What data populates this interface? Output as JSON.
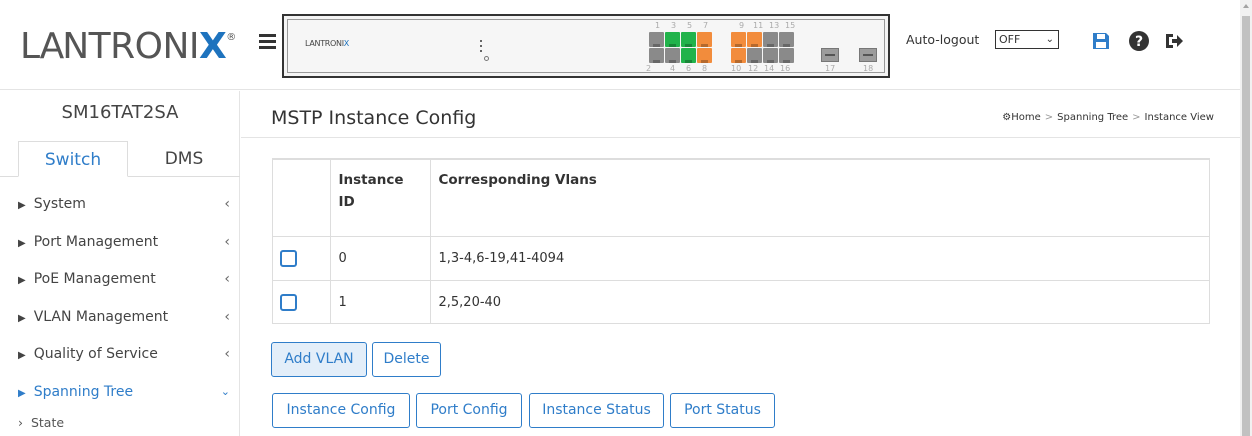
{
  "header": {
    "logo_text": "LANTRONIX",
    "logo_reg": "®",
    "device_brand": "LANTRONIX",
    "port_numbers_top": [
      "1",
      "3",
      "5",
      "7",
      "9",
      "11",
      "13",
      "15"
    ],
    "port_numbers_bottom": [
      "2",
      "4",
      "6",
      "8",
      "10",
      "12",
      "14",
      "16",
      "17",
      "18"
    ],
    "autologout_label": "Auto-logout",
    "autologout_value": "OFF",
    "icons": [
      "save-icon",
      "help-icon",
      "logout-icon"
    ],
    "accent_color": "#2f7dc9"
  },
  "sidebar": {
    "device_name": "SM16TAT2SA",
    "tabs": [
      {
        "label": "Switch",
        "active": true
      },
      {
        "label": "DMS",
        "active": false
      }
    ],
    "items": [
      {
        "label": "System"
      },
      {
        "label": "Port Management"
      },
      {
        "label": "PoE Management"
      },
      {
        "label": "VLAN Management"
      },
      {
        "label": "Quality of Service"
      },
      {
        "label": "Spanning Tree",
        "active": true
      }
    ],
    "subitem": "State"
  },
  "main": {
    "title": "MSTP Instance Config",
    "breadcrumb": [
      "Home",
      "Spanning Tree",
      "Instance View"
    ],
    "table": {
      "headers": [
        "",
        "Instance ID",
        "Corresponding Vlans"
      ],
      "header_id_line1": "Instance",
      "header_id_line2": "ID",
      "rows": [
        {
          "id": "0",
          "vlans": "1,3-4,6-19,41-4094"
        },
        {
          "id": "1",
          "vlans": "2,5,20-40"
        }
      ]
    },
    "buttons": {
      "add_vlan": "Add VLAN",
      "delete": "Delete",
      "instance_config": "Instance Config",
      "port_config": "Port Config",
      "instance_status": "Instance Status",
      "port_status": "Port Status"
    }
  }
}
